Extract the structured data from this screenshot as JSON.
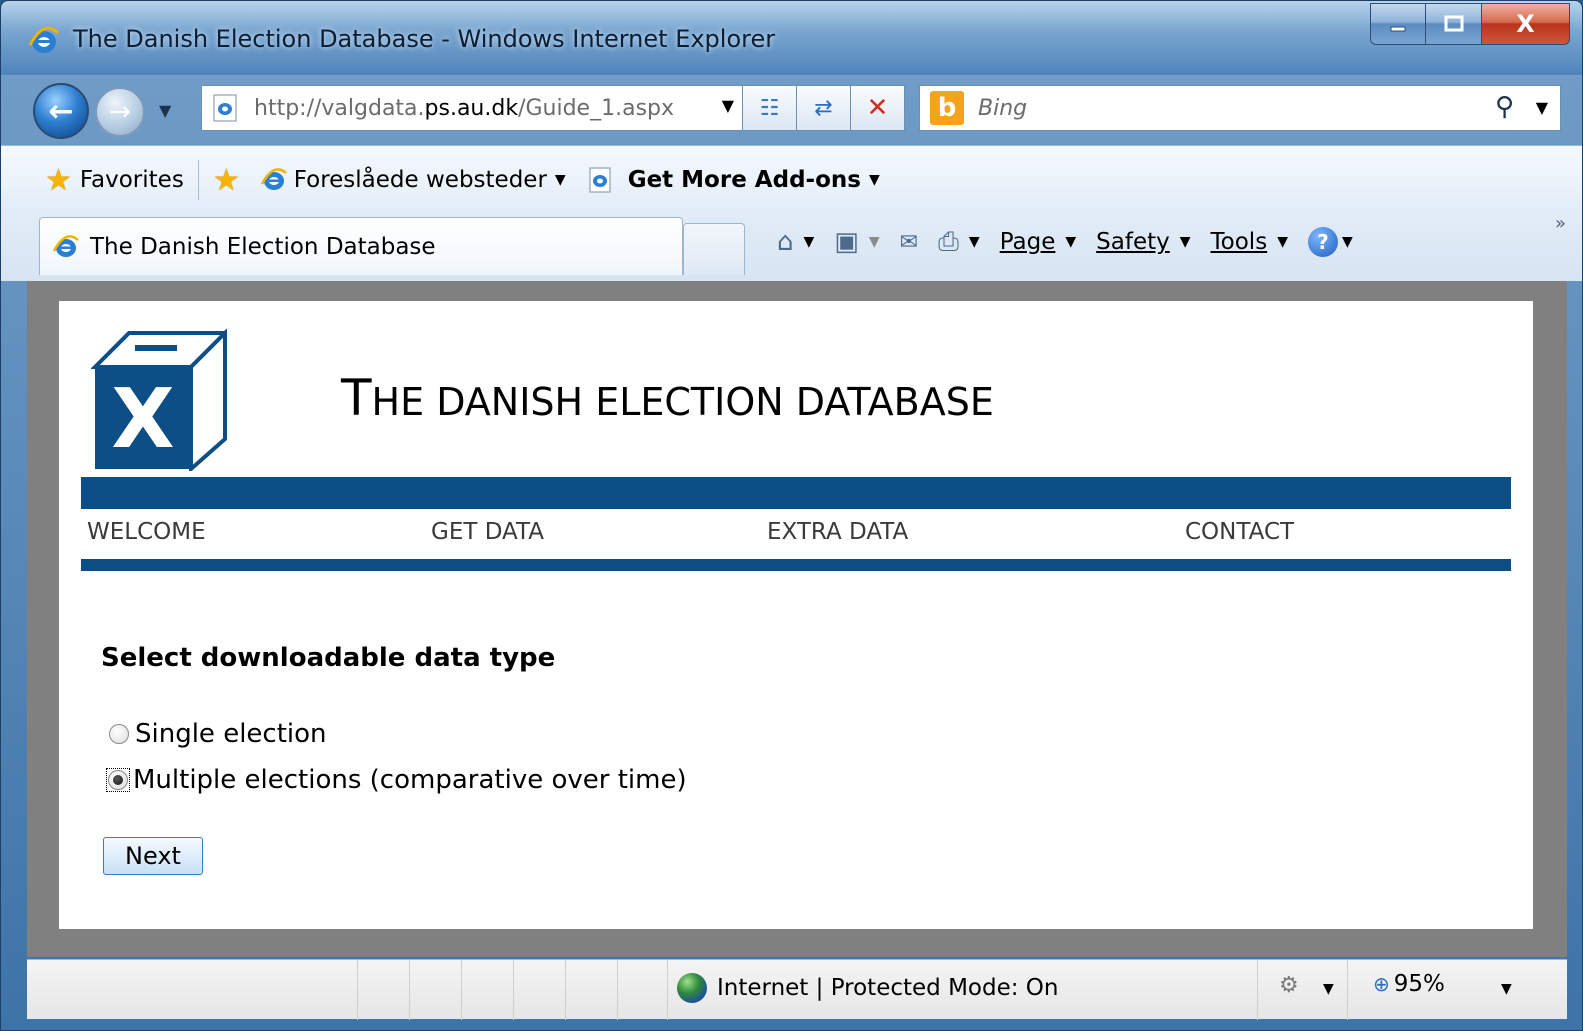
{
  "window": {
    "title": "The Danish Election Database - Windows Internet Explorer",
    "controls": {
      "close": "X"
    }
  },
  "navbar": {
    "url_prefix": "http://valgdata.",
    "url_domain": "ps.au.dk",
    "url_suffix": "/Guide_1.aspx",
    "search_placeholder": "Bing",
    "search_logo": "b"
  },
  "favorites_bar": {
    "favorites_label": "Favorites",
    "suggested_sites": "Foreslåede websteder",
    "get_addons": "Get More Add-ons"
  },
  "tab": {
    "title": "The Danish Election Database"
  },
  "command_bar": {
    "page": "Page",
    "safety": "Safety",
    "tools": "Tools",
    "help": "?",
    "overflow": "»"
  },
  "site": {
    "title_first": "T",
    "title_rest": "HE DANISH ELECTION DATABASE",
    "logo_letter": "X",
    "menu": [
      "WELCOME",
      "GET DATA",
      "EXTRA DATA",
      "CONTACT"
    ]
  },
  "form": {
    "heading": "Select downloadable data type",
    "options": [
      {
        "label": "Single election",
        "selected": false
      },
      {
        "label": "Multiple elections (comparative over time)",
        "selected": true
      }
    ],
    "next_label": "Next"
  },
  "statusbar": {
    "zone": "Internet | Protected Mode: On",
    "zoom": "95%"
  },
  "colors": {
    "brand_blue": "#0b4f86",
    "viewport_gray": "#808080"
  }
}
